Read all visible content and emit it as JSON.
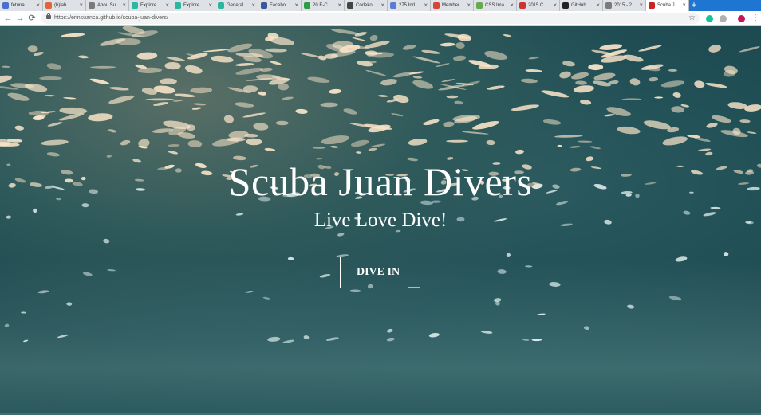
{
  "browser": {
    "tabs": [
      {
        "label": "fetuna",
        "color": "#4a6fd0"
      },
      {
        "label": "(b)lab",
        "color": "#e2643a"
      },
      {
        "label": "Abou Su",
        "color": "#7a7a7a"
      },
      {
        "label": "Explore",
        "color": "#2bb6a0"
      },
      {
        "label": "Explore",
        "color": "#2bb6a0"
      },
      {
        "label": "General",
        "color": "#2bb6a0"
      },
      {
        "label": "Facebo",
        "color": "#3b5998"
      },
      {
        "label": "20 E-C",
        "color": "#2b9e48"
      },
      {
        "label": "Codeko",
        "color": "#444444"
      },
      {
        "label": "275 Ind",
        "color": "#5b7bd5"
      },
      {
        "label": "Member",
        "color": "#d44638"
      },
      {
        "label": "CSS Ima",
        "color": "#6aa84f"
      },
      {
        "label": "2015 C",
        "color": "#cc3333"
      },
      {
        "label": "GitHub",
        "color": "#222222"
      },
      {
        "label": "2015 - 2",
        "color": "#7a7a7a"
      },
      {
        "label": "Scuba J",
        "color": "#cc2222"
      }
    ],
    "active_tab_index": 15,
    "close_glyph": "×",
    "new_tab_glyph": "+",
    "back_glyph": "←",
    "forward_glyph": "→",
    "reload_glyph": "⟳",
    "url": "https://erinsuanca.github.io/scuba-juan-divers/",
    "star_glyph": "☆",
    "menu_glyph": "⋮",
    "extensions": [
      {
        "name": "grammarly-icon",
        "color": "#15c39a"
      },
      {
        "name": "extension-icon",
        "color": "#b0b0b0"
      },
      {
        "name": "profile-avatar",
        "color": "#c2185b"
      }
    ]
  },
  "hero": {
    "title": "Scuba Juan Divers",
    "subtitle": "Live Love Dive!",
    "cta_label": "DIVE IN"
  },
  "colors": {
    "tabstrip": "#1e76d2",
    "water_dark": "#1e4b52",
    "text": "#ffffff"
  }
}
